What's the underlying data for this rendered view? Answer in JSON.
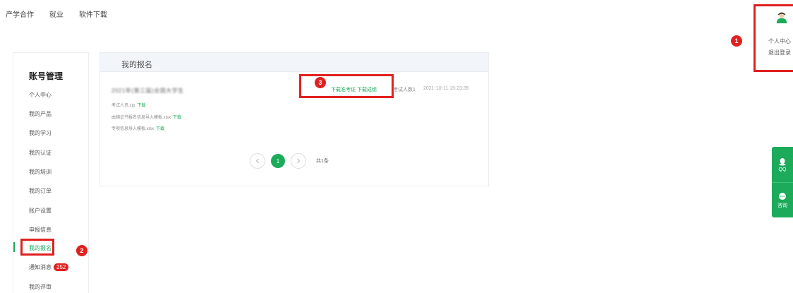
{
  "topnav": {
    "items": [
      "产学合作",
      "就业",
      "软件下载"
    ]
  },
  "user_panel": {
    "center_label": "个人中心",
    "logout_label": "退出登录"
  },
  "markers": {
    "m1": "1",
    "m2": "2",
    "m3": "3"
  },
  "sidebar": {
    "title": "账号管理",
    "items": [
      "个人中心",
      "我的产品",
      "我的学习",
      "我的认证",
      "我的培训",
      "我的订单",
      "账户设置",
      "申报信息",
      "我的报名",
      "通知消息",
      "我的评审"
    ],
    "active_index": 8,
    "notify_badge": "252"
  },
  "main": {
    "title": "我的报名",
    "record": {
      "name": "2021年(第三届)全国大学生",
      "dl_admission": "下载准考证",
      "dl_score": "下载成绩",
      "count": "考试人数1",
      "time": "2021-10-11 15:23:39"
    },
    "files": [
      {
        "name": "考试人员.zip",
        "action": "下载"
      },
      {
        "name": "由辅证书报名信息导入模板.xlsx",
        "action": "下载"
      },
      {
        "name": "专项信息导入模板.xlsx",
        "action": "下载"
      }
    ],
    "pagination": {
      "current": "1",
      "total": "共1条"
    }
  },
  "float_panel": {
    "qq_label": "QQ",
    "consult_label": "咨询"
  },
  "colors": {
    "accent": "#1cab5b",
    "highlight": "#e02020"
  }
}
